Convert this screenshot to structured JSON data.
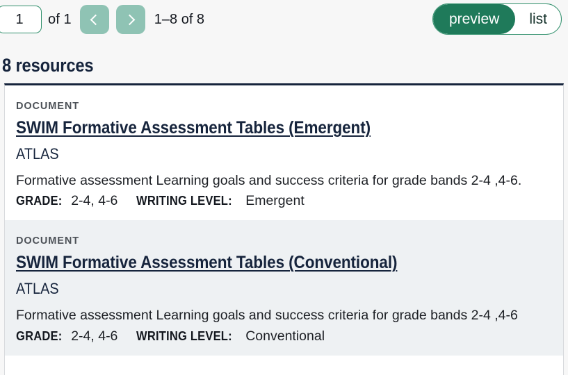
{
  "toolbar": {
    "page_input_value": "1",
    "page_input_placeholder": "1",
    "of_label": "of 1",
    "prev_button_label": "‹",
    "next_button_label": "›",
    "range_label": "1–8 of 8",
    "view_toggle": {
      "preview_label": "preview",
      "list_label": "list",
      "active": "preview"
    }
  },
  "section": {
    "heading": "8 resources"
  },
  "colors": {
    "accent_green": "#1f7a5a",
    "accent_green_muted": "#8fc3b4",
    "heading_navy": "#16243c",
    "page_background": "#f7f7f7",
    "alt_row_background": "#eef1f3"
  },
  "results": [
    {
      "kind": "DOCUMENT",
      "title": "SWIM Formative Assessment Tables (Emergent)",
      "source": "ATLAS",
      "description": "Formative assessment Learning goals and success criteria for grade bands 2-4 ,4-6.",
      "meta": [
        {
          "label": "GRADE:",
          "value": "2-4, 4-6"
        },
        {
          "label": "WRITING LEVEL:",
          "value": "Emergent"
        }
      ]
    },
    {
      "kind": "DOCUMENT",
      "title": "SWIM Formative Assessment Tables (Conventional)",
      "source": "ATLAS",
      "description": "Formative assessment Learning goals and success criteria for grade bands 2-4 ,4-6",
      "meta": [
        {
          "label": "GRADE:",
          "value": "2-4, 4-6"
        },
        {
          "label": "WRITING LEVEL:",
          "value": "Conventional"
        }
      ]
    }
  ]
}
